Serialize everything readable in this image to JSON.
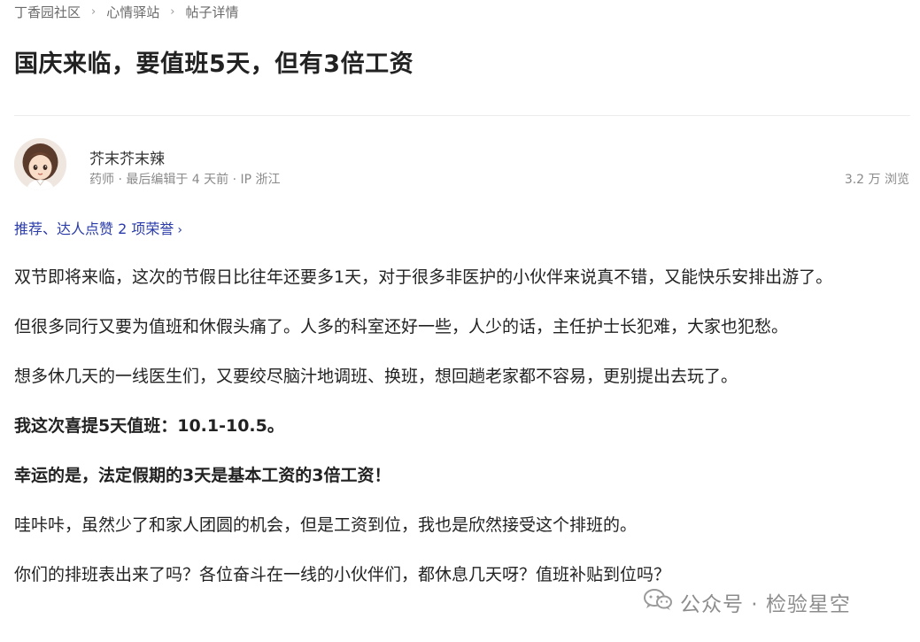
{
  "breadcrumb": {
    "items": [
      "丁香园社区",
      "心情驿站",
      "帖子详情"
    ],
    "separator": "›"
  },
  "post": {
    "title": "国庆来临，要值班5天，但有3倍工资"
  },
  "author": {
    "name": "芥末芥末辣",
    "meta": "药师 · 最后编辑于 4 天前 · IP 浙江",
    "views": "3.2 万 浏览",
    "avatar_icon": "avatar-girl-illustration"
  },
  "honors": {
    "label": "推荐、达人点赞 2 项荣誉",
    "chevron": "›"
  },
  "content": {
    "p1": "双节即将来临，这次的节假日比往年还要多1天，对于很多非医护的小伙伴来说真不错，又能快乐安排出游了。",
    "p2": "但很多同行又要为值班和休假头痛了。人多的科室还好一些，人少的话，主任护士长犯难，大家也犯愁。",
    "p3": "想多休几天的一线医生们，又要绞尽脑汁地调班、换班，想回趟老家都不容易，更别提出去玩了。",
    "p4": "我这次喜提5天值班：10.1-10.5。",
    "p5": "幸运的是，法定假期的3天是基本工资的3倍工资！",
    "p6": "哇咔咔，虽然少了和家人团圆的机会，但是工资到位，我也是欣然接受这个排班的。",
    "p7": "你们的排班表出来了吗？各位奋斗在一线的小伙伴们，都休息几天呀？值班补贴到位吗？"
  },
  "watermark": {
    "text": "公众号 · 检验星空",
    "icon": "wechat-icon"
  },
  "colors": {
    "link": "#2b3caa",
    "text": "#222222",
    "muted": "#8a8a8a"
  }
}
